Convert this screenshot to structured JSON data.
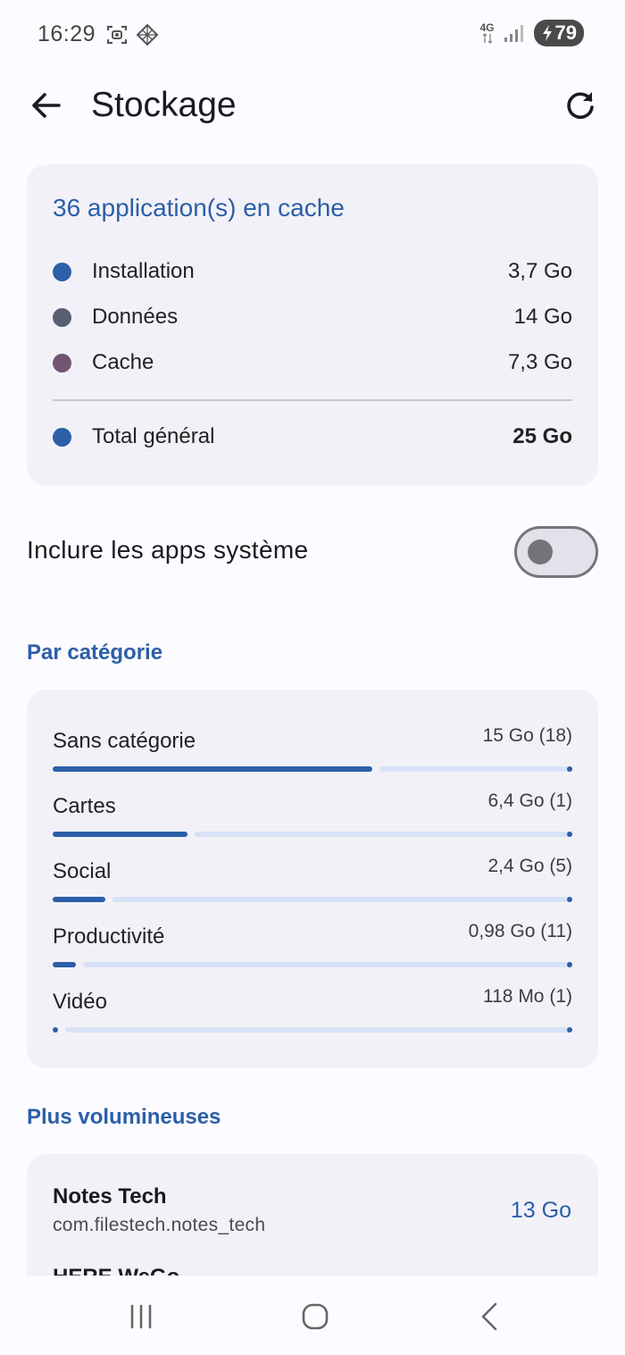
{
  "status_bar": {
    "time": "16:29",
    "network": "4G",
    "battery": "79",
    "icons": [
      "screenshot-icon",
      "diamond-grid-icon",
      "signal-icon",
      "battery-charging-icon"
    ]
  },
  "app_bar": {
    "title": "Stockage"
  },
  "summary": {
    "title": "36 application(s) en cache",
    "rows": [
      {
        "label": "Installation",
        "value": "3,7 Go",
        "color": "#2b5fa8"
      },
      {
        "label": "Données",
        "value": "14 Go",
        "color": "#585e71"
      },
      {
        "label": "Cache",
        "value": "7,3 Go",
        "color": "#715573"
      }
    ],
    "total": {
      "label": "Total général",
      "value": "25 Go",
      "color": "#2b5fa8"
    }
  },
  "toggle": {
    "label": "Inclure les apps système",
    "checked": false
  },
  "categories": {
    "heading": "Par catégorie",
    "items": [
      {
        "name": "Sans catégorie",
        "value": "15 Go (18)",
        "fraction": 0.615
      },
      {
        "name": "Cartes",
        "value": "6,4 Go (1)",
        "fraction": 0.26
      },
      {
        "name": "Social",
        "value": "2,4 Go (5)",
        "fraction": 0.102
      },
      {
        "name": "Productivité",
        "value": "0,98 Go (11)",
        "fraction": 0.045
      },
      {
        "name": "Vidéo",
        "value": "118 Mo (1)",
        "fraction": 0.007
      }
    ]
  },
  "largest": {
    "heading": "Plus volumineuses",
    "apps": [
      {
        "name": "Notes Tech",
        "package": "com.filestech.notes_tech",
        "size": "13 Go"
      },
      {
        "name": "HERE WeGo",
        "package": "",
        "size": ""
      }
    ]
  },
  "nav": {
    "icons": [
      "recents-icon",
      "home-icon",
      "back-nav-icon"
    ]
  }
}
